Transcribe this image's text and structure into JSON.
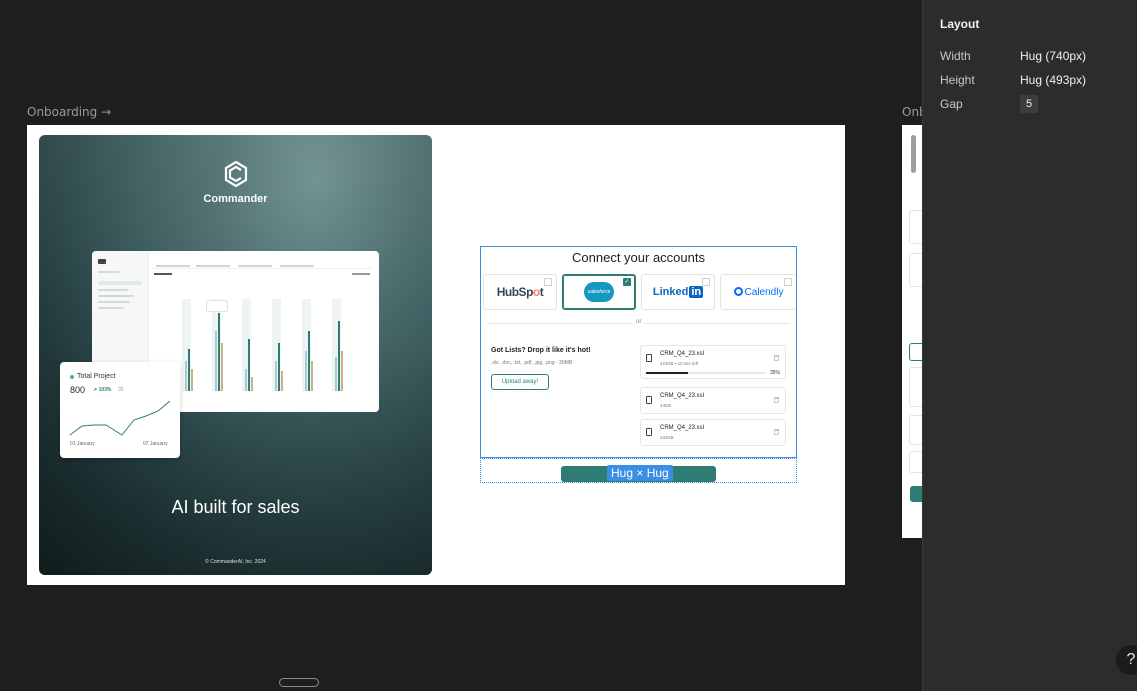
{
  "canvas": {
    "frame_1_label": "Onboarding →",
    "frame_2_label": "Onboarding →"
  },
  "hero": {
    "brand": "Commander",
    "tagline": "AI built for sales",
    "copyright": "© CommanderAI, Inc. 2024",
    "card": {
      "title": "Total Project",
      "value": "800",
      "trend": "103%",
      "sub": "35",
      "date_start": "01 January",
      "date_end": "07 January",
      "trend_color": "#2b7d73"
    }
  },
  "connect": {
    "title": "Connect your accounts",
    "accounts": [
      {
        "name": "HubSpot",
        "selected": false
      },
      {
        "name": "salesforce",
        "selected": true
      },
      {
        "name": "LinkedIn",
        "selected": false
      },
      {
        "name": "Calendly",
        "selected": false
      }
    ],
    "or": "or",
    "drop_title": "Got Lists? Drop it like it's hot!",
    "drop_sub": ".xls, .doc, .txt, .pdf, .jpg, .png · 30MB",
    "upload_label": "Upload away!",
    "files": [
      {
        "name": "CRM_Q4_23.xsl",
        "meta": "424KB • 10 sec left",
        "progress": "35%"
      },
      {
        "name": "CRM_Q4_23.xsl",
        "meta": "44KB"
      },
      {
        "name": "CRM_Q4_23.xsl",
        "meta": "234KB"
      }
    ],
    "accent_color": "#2f7c74"
  },
  "selection": {
    "badge": "Hug × Hug"
  },
  "inspector": {
    "title": "Layout",
    "width_label": "Width",
    "width_value": "Hug (740px)",
    "height_label": "Height",
    "height_value": "Hug (493px)",
    "gap_label": "Gap",
    "gap_value": "5",
    "help": "?"
  }
}
